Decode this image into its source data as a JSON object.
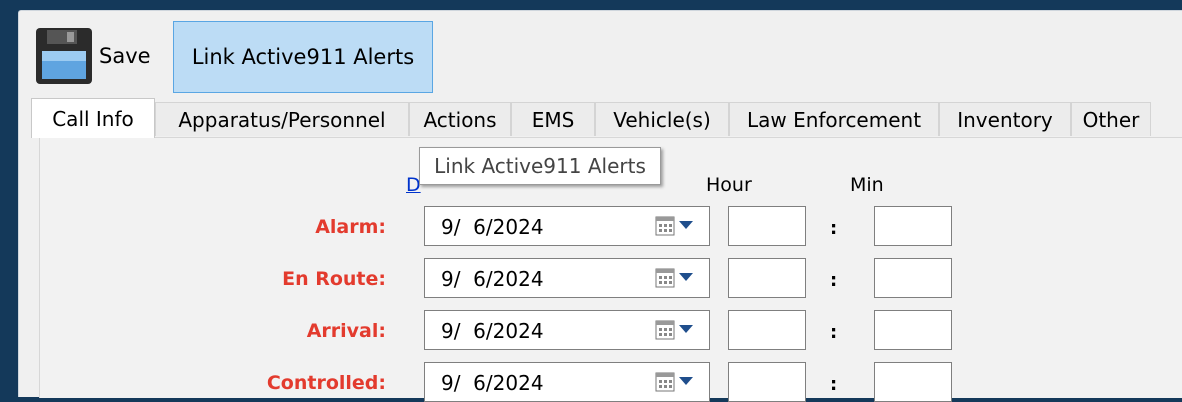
{
  "toolbar": {
    "save_label": "Save",
    "link_label": "Link Active911 Alerts"
  },
  "tabs": [
    {
      "label": "Call Info",
      "active": true
    },
    {
      "label": "Apparatus/Personnel"
    },
    {
      "label": "Actions"
    },
    {
      "label": "EMS"
    },
    {
      "label": "Vehicle(s)"
    },
    {
      "label": "Law Enforcement"
    },
    {
      "label": "Inventory"
    },
    {
      "label": "Other"
    }
  ],
  "tooltip": "Link Active911 Alerts",
  "headers": {
    "date_partial": "D",
    "hour": "Hour",
    "min": "Min"
  },
  "time_separator": ":",
  "rows": [
    {
      "label": "Alarm:",
      "date": "9/  6/2024",
      "hour": "",
      "min": ""
    },
    {
      "label": "En Route:",
      "date": "9/  6/2024",
      "hour": "",
      "min": ""
    },
    {
      "label": "Arrival:",
      "date": "9/  6/2024",
      "hour": "",
      "min": ""
    },
    {
      "label": "Controlled:",
      "date": "9/  6/2024",
      "hour": "",
      "min": ""
    }
  ],
  "colors": {
    "label_red": "#e33b2e",
    "highlight_blue": "#bcdcf5",
    "background_navy": "#14395a"
  }
}
